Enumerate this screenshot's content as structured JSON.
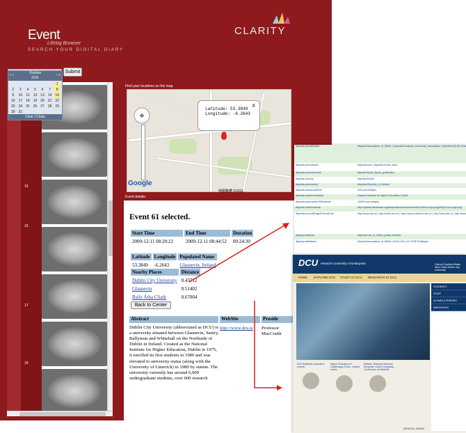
{
  "app": {
    "title": "Event",
    "title_sub": "Lifelog Browser",
    "tagline": "SEARCH YOUR DIGITAL DIARY",
    "brand": "CLARITY",
    "submit_label": "Submit",
    "find_label": "Find your locations on the map.",
    "event_details_label": "Event details:"
  },
  "calendar": {
    "prev": "« ‹",
    "next": "› »",
    "month": "October",
    "year": "2011",
    "days": [
      "",
      "",
      "",
      "",
      "",
      "",
      "1",
      "2",
      "3",
      "4",
      "5",
      "6",
      "7",
      "8",
      "9",
      "10",
      "11",
      "12",
      "13",
      "14",
      "15",
      "16",
      "17",
      "18",
      "19",
      "20",
      "21",
      "22",
      "23",
      "24",
      "25",
      "26",
      "27",
      "28",
      "29",
      "30",
      "31"
    ],
    "footer": "Clear | Close"
  },
  "strip": {
    "row_numbers": [
      "15",
      "16",
      "17",
      "18"
    ]
  },
  "map": {
    "latitude_label": "Latitude:",
    "latitude": "53.3849",
    "longitude_label": "Longitude:",
    "longitude": "-6.2643",
    "close": "X",
    "google": "Google",
    "copyright": "地图数据 ©2011"
  },
  "event": {
    "title": "Event 61 selected.",
    "time_headers": [
      "Start Time",
      "End Time",
      "Duration"
    ],
    "time_values": [
      "2009-12-11 08:20:22",
      "2009-12-11 08:44:52",
      "00:24:30"
    ],
    "loc_headers": [
      "Latitude",
      "Longitude",
      "Populated Name"
    ],
    "loc_values": [
      "53.3849",
      "-6.2643",
      "Glasnevin, Ireland"
    ],
    "nearby_headers": [
      "Nearby Places",
      "Distance"
    ],
    "nearby": [
      {
        "name": "Dublin City University",
        "distance": "0.43712"
      },
      {
        "name": "Glasnevin",
        "distance": "0.51402"
      },
      {
        "name": "Baile Átha Cliath",
        "distance": "0.67004"
      }
    ],
    "back_button": "Back to Center",
    "abstract_header": "Abstract",
    "website_header": "WebSite",
    "president_header": "Preside",
    "abstract": "Dublin City University (abbreviated as DCU) is a university situated between Glasnevin, Santry, Ballymun and Whitehall on the Northside of Dublin in Ireland. Created as the National Institute for Higher Education, Dublin in 1975, it enrolled its first students in 1980 and was elevated to university status (along with the University of Limerick) in 1989 by statute. The university currently has around 6,000 undergraduate students, over 600 research",
    "website": "http://www.dcu.ie",
    "president": "Professor MacCraith"
  },
  "dbpedia": {
    "rows": [
      {
        "k": "dbpedia-owl:affiliation",
        "v": "dbpedia:Association_of_MBAs | dbpedia:European_University_Association | dbpedia:EQUIS_Business_School | dbpedia:Universities_Ireland | dbpedia:Irish_Universities_Association"
      },
      {
        "k": "dbpedia-owl:campus",
        "v": "dbpedia:Acre | dbpedia:Urban_area"
      },
      {
        "k": "dbpedia-owl:chancellor",
        "v": "dbpedia:David_Byrne_(politician)"
      },
      {
        "k": "dbpedia-owl:city",
        "v": "dbpedia:Dublin"
      },
      {
        "k": "dbpedia-owl:country",
        "v": "dbpedia:Republic_of_Ireland"
      },
      {
        "k": "dbpedia-owl:facultySize",
        "v": "449 (xsd:integer)"
      },
      {
        "k": "dbpedia-owl:formerName",
        "v": "National Institute for Higher Education, Dublin"
      },
      {
        "k": "dbpedia-owl:numberOfStudents",
        "v": "10000 (xsd:integer)"
      },
      {
        "k": "dbpedia-owl:thumbnail",
        "v": "http://upload.wikimedia.org/wikipedia/commons/thumb/1/1a/Dcu-logo.png/200px-Dcu-logo.png"
      },
      {
        "k": "dbpedia-owl:wikiPageExternalLink",
        "v": "http://www.dcu.ie/ | http://www.dcu.ie/ | https://www.cauldron.dcu.ie/ | http://www.dcu.ie | http://www.dcufm.com | http://www.dcumusic.com | http://www.dcu.ie"
      },
      {
        "k": "dbpprop:address",
        "v": "dbpedia:List_of_Dublin_postal_districts"
      },
      {
        "k": "dbpprop:affiliations",
        "v": "dbpedia:Association_of_MBAs | EUA | IUA | UI | ESB Realtingen"
      },
      {
        "k": "dbpprop:alumni",
        "v": "30000 (xsd:integer)"
      },
      {
        "k": "dbpprop:campus",
        "v": "136800.0"
      },
      {
        "k": "dbpprop:chancellor",
        "v": "Mr. David Byrne"
      }
    ]
  },
  "dcu_site": {
    "logo": "DCU",
    "tagline": "Ireland's University of Enterprise",
    "irish": "Ollscoil Chathair Bhaile Átha Cliath Dublin City University",
    "nav": [
      "HOME",
      "EXPLORE DCU",
      "STUDY AT DCU",
      "RESEARCH AT DCU"
    ],
    "side_links": [
      "STUDENTS",
      "STAFF",
      "ALUMNI & FRIENDS",
      "INNOVATION"
    ],
    "news": [
      "DCU Business Innovation Launch",
      "Higher Education in Challenging Times - lecture series",
      "Minister Sherlock launches European Cloud Computing Conference at DublinIN"
    ],
    "view_all": "VIEW ALL NEWS"
  }
}
